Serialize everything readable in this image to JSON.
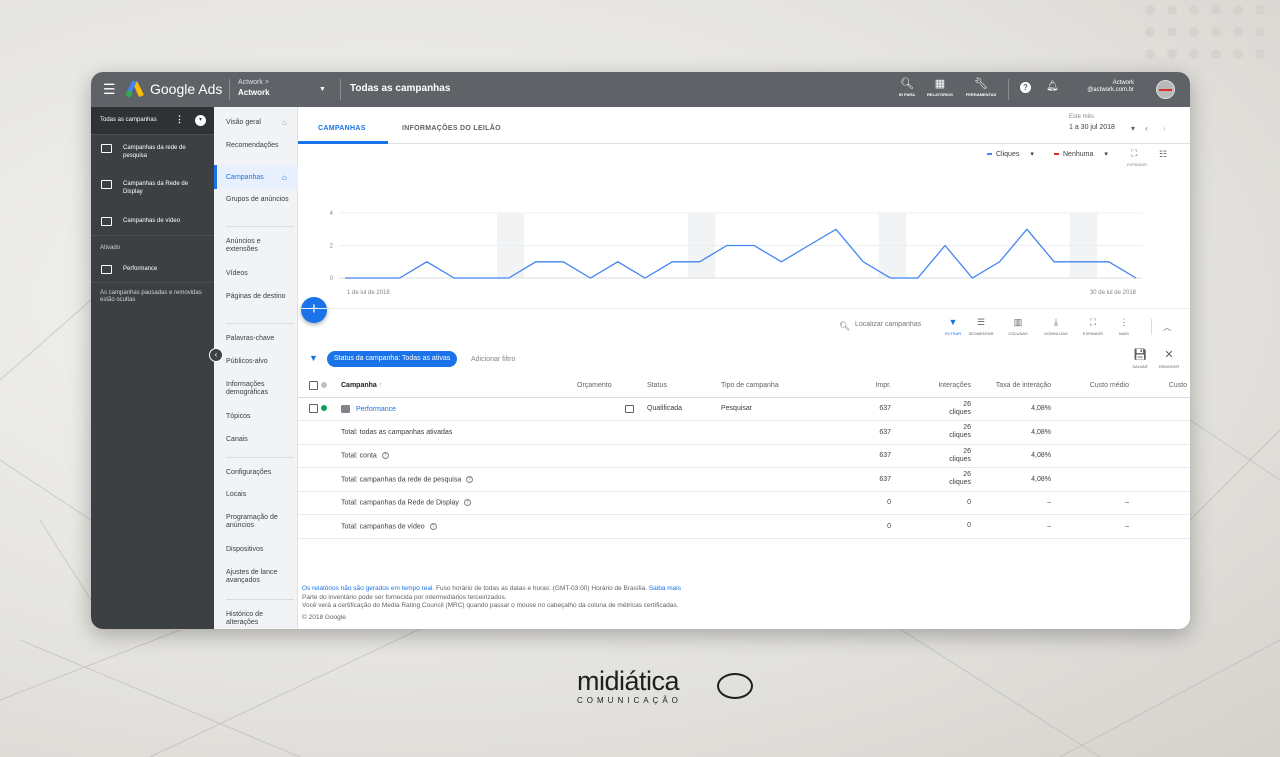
{
  "topbar": {
    "brand": "Google Ads",
    "account_small": "Actwork >",
    "account_name": "Actwork",
    "page_title": "Todas as campanhas",
    "tools": [
      {
        "icon": "search-icon",
        "label": "IR PARA"
      },
      {
        "icon": "reports-icon",
        "label": "RELATÓRIOS"
      },
      {
        "icon": "wrench-icon",
        "label": "FERRAMENTAS"
      }
    ],
    "user_name": "Actwork",
    "user_email": "@actwork.com.br"
  },
  "sidebar": {
    "header": "Todas as campanhas",
    "campaigns": [
      {
        "icon": "search-campaign-icon",
        "label": "Campanhas da rede de pesquisa"
      },
      {
        "icon": "display-campaign-icon",
        "label": "Campanhas da Rede de Display"
      },
      {
        "icon": "video-campaign-icon",
        "label": "Campanhas de vídeo"
      }
    ],
    "section_label": "Ativado",
    "active_campaign": "Performance",
    "note": "As campanhas pausadas e removidas estão ocultas"
  },
  "nav": {
    "items": [
      {
        "label": "Visão geral"
      },
      {
        "label": "Recomendações"
      },
      {
        "label": "Campanhas"
      },
      {
        "label": "Grupos de anúncios"
      },
      {
        "label": "Anúncios e extensões"
      },
      {
        "label": "Vídeos"
      },
      {
        "label": "Páginas de destino"
      },
      {
        "label": "Palavras-chave"
      },
      {
        "label": "Públicos-alvo"
      },
      {
        "label": "Informações demográficas"
      },
      {
        "label": "Tópicos"
      },
      {
        "label": "Canais"
      },
      {
        "label": "Configurações"
      },
      {
        "label": "Locais"
      },
      {
        "label": "Programação de anúncios"
      },
      {
        "label": "Dispositivos"
      },
      {
        "label": "Ajustes de lance avançados"
      },
      {
        "label": "Histórico de alterações"
      }
    ]
  },
  "tabs": [
    {
      "label": "CAMPANHAS"
    },
    {
      "label": "INFORMAÇÕES DO LEILÃO"
    }
  ],
  "daterange": {
    "label": "Este mês",
    "value": "1 a 30 jul 2018"
  },
  "chart_controls": {
    "metric1": "Cliques",
    "metric2": "Nenhuma",
    "expand_label": "EXPANDIR",
    "metric1_color": "#4285f4",
    "metric2_color": "#d93025"
  },
  "chart_data": {
    "type": "line",
    "x": [
      "1 jul",
      "2 jul",
      "3 jul",
      "4 jul",
      "5 jul",
      "6 jul",
      "7 jul",
      "8 jul",
      "9 jul",
      "10 jul",
      "11 jul",
      "12 jul",
      "13 jul",
      "14 jul",
      "15 jul",
      "16 jul",
      "17 jul",
      "18 jul",
      "19 jul",
      "20 jul",
      "21 jul",
      "22 jul",
      "23 jul",
      "24 jul",
      "25 jul",
      "26 jul",
      "27 jul",
      "28 jul",
      "29 jul",
      "30 jul"
    ],
    "series": [
      {
        "name": "Cliques",
        "values": [
          0,
          0,
          0,
          1,
          0,
          0,
          0,
          1,
          1,
          0,
          1,
          0,
          1,
          1,
          2,
          2,
          1,
          2,
          3,
          1,
          0,
          0,
          2,
          0,
          1,
          3,
          1,
          1,
          1,
          0
        ]
      }
    ],
    "ylim": [
      0,
      4
    ],
    "yticks": [
      "0",
      "2",
      "4"
    ],
    "x_start_label": "1 de jul de 2018",
    "x_end_label": "30 de jul de 2018",
    "color": "#4285f4"
  },
  "toolbar": {
    "search_placeholder": "Localizar campanhas",
    "buttons": [
      {
        "icon": "filter-icon",
        "label": "FILTRAR"
      },
      {
        "icon": "segment-icon",
        "label": "SEGMENTAR"
      },
      {
        "icon": "columns-icon",
        "label": "COLUNAS"
      },
      {
        "icon": "download-icon",
        "label": "DOWNLOAD"
      },
      {
        "icon": "expand-icon",
        "label": "EXPANDIR"
      },
      {
        "icon": "more-icon",
        "label": "MAIS"
      }
    ]
  },
  "filterbar": {
    "chip": "Status da campanha: Todas as ativas",
    "add_filter": "Adicionar filtro",
    "save_label": "SALVAR",
    "remove_label": "REMOVER"
  },
  "table": {
    "headers": {
      "campaign": "Campanha",
      "budget": "Orçamento",
      "status": "Status",
      "type": "Tipo de campanha",
      "impr": "Impr.",
      "interactions": "Interações",
      "rate": "Taxa de interação",
      "avg_cost": "Custo médio",
      "cost": "Custo"
    },
    "campaign_row": {
      "name": "Performance",
      "status": "Qualificada",
      "type": "Pesquisar",
      "impr": "637",
      "interactions": "26",
      "interactions_unit": "cliques",
      "rate": "4,08%"
    },
    "totals": [
      {
        "label": "Total: todas as campanhas ativadas",
        "impr": "637",
        "interactions": "26",
        "unit": "cliques",
        "rate": "4,08%",
        "avg": "",
        "help": false
      },
      {
        "label": "Total: conta",
        "impr": "637",
        "interactions": "26",
        "unit": "cliques",
        "rate": "4,08%",
        "avg": "",
        "help": true
      },
      {
        "label": "Total: campanhas da rede de pesquisa",
        "impr": "637",
        "interactions": "26",
        "unit": "cliques",
        "rate": "4,08%",
        "avg": "",
        "help": true
      },
      {
        "label": "Total: campanhas da Rede de Display",
        "impr": "0",
        "interactions": "0",
        "unit": "",
        "rate": "–",
        "avg": "–",
        "help": true
      },
      {
        "label": "Total: campanhas de vídeo",
        "impr": "0",
        "interactions": "0",
        "unit": "",
        "rate": "–",
        "avg": "–",
        "help": true
      }
    ]
  },
  "footer": {
    "link1": "Os relatórios não são gerados em tempo real.",
    "text1": " Fuso horário de todas as datas e horas: (GMT-03:00) Horário de Brasília.",
    "link2": " Saiba mais",
    "line2": "Parte do inventário pode ser fornecida por intermediários terceirizados.",
    "line3": "Você verá a certificação do Media Rating Council (MRC) quando passar o mouse no cabeçalho da coluna de métricas certificadas.",
    "copyright": "© 2018 Google"
  },
  "watermark": {
    "word": "midiática",
    "sub": "COMUNICAÇÃO"
  }
}
